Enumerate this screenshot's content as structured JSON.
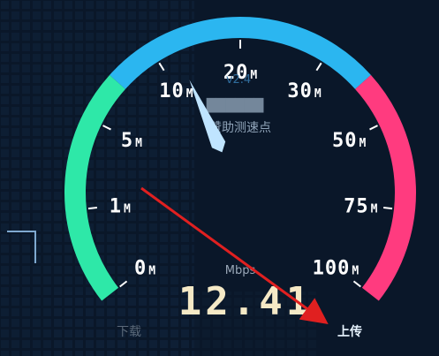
{
  "gauge": {
    "version": "v2.4",
    "node_name_blurred": "██████",
    "node_caption": "赞助测速点",
    "unit_label": "Mbps",
    "speed_value": "12.41",
    "ticks": [
      {
        "num": "0",
        "unit": "M"
      },
      {
        "num": "1",
        "unit": "M"
      },
      {
        "num": "5",
        "unit": "M"
      },
      {
        "num": "10",
        "unit": "M"
      },
      {
        "num": "20",
        "unit": "M"
      },
      {
        "num": "30",
        "unit": "M"
      },
      {
        "num": "50",
        "unit": "M"
      },
      {
        "num": "75",
        "unit": "M"
      },
      {
        "num": "100",
        "unit": "M"
      }
    ],
    "needle_value_mbps": 12.41,
    "colors": {
      "low": "#2ee8a8",
      "mid": "#2bb6f0",
      "high": "#ff3b7f",
      "needle": "#bfe4ff",
      "arrow": "#e02020"
    }
  },
  "tabs": {
    "download": "下载",
    "upload": "上传"
  }
}
